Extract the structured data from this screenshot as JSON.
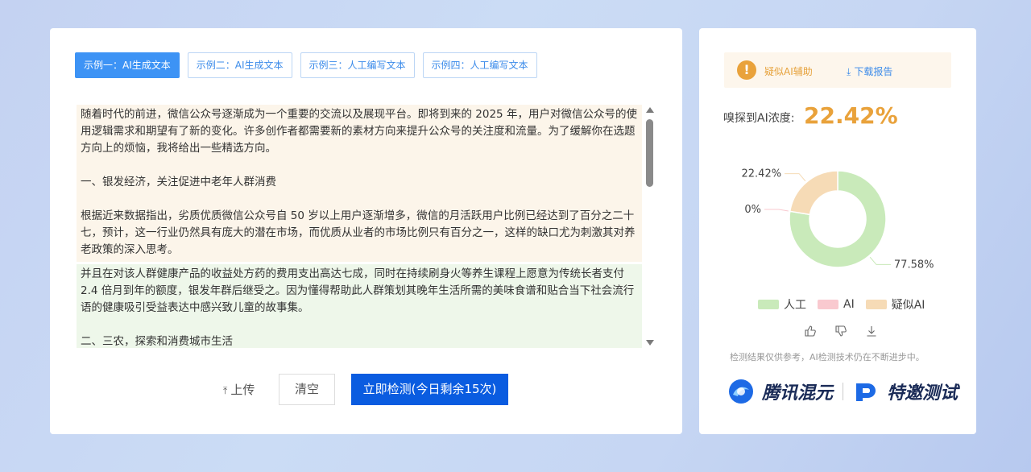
{
  "tabs": [
    {
      "label": "示例一：AI生成文本",
      "active": true
    },
    {
      "label": "示例二：AI生成文本",
      "active": false
    },
    {
      "label": "示例三：人工编写文本",
      "active": false
    },
    {
      "label": "示例四：人工编写文本",
      "active": false
    }
  ],
  "text": {
    "para1": "随着时代的前进，微信公众号逐渐成为一个重要的交流以及展现平台。即将到来的 2025 年，用户对微信公众号的使用逻辑需求和期望有了新的变化。许多创作者都需要新的素材方向来提升公众号的关注度和流量。为了缓解你在选题方向上的烦恼，我将给出一些精选方向。",
    "para2": "一、银发经济，关注促进中老年人群消费",
    "para3": "根据近来数据指出，劣质优质微信公众号自 50 岁以上用户逐渐增多，微信的月活跃用户比例已经达到了百分之二十七，预计，这一行业仍然具有庞大的潜在市场，而优质从业者的市场比例只有百分之一，这样的缺口尤为刺激其对养老政策的深入思考。",
    "para4": "并且在对该人群健康产品的收益处方药的费用支出高达七成，同时在持续刷身火等养生课程上愿意为传统长者支付 2.4 倍月到年的额度，银发年群后继受之。因为懂得帮助此人群策划其晚年生活所需的美味食谱和贴合当下社会流行语的健康吸引受益表达中感兴致儿童的故事集。",
    "para5": "二、三农，探索和消费城市生活"
  },
  "actions": {
    "upload_label": "上传",
    "clear_label": "清空",
    "detect_label": "立即检测(今日剩余15次)"
  },
  "result": {
    "alert_icon": "!",
    "alert_text": "疑似AI辅助",
    "download_label": "下载报告",
    "concentration_label": "嗅探到AI浓度:",
    "concentration_value": "22.42%",
    "disclaimer": "检测结果仅供参考，AI检测技术仍在不断进步中。",
    "brand_tencent": "腾讯混元",
    "brand_test": "特邀测试"
  },
  "chart_data": {
    "type": "pie",
    "style": "donut",
    "series": [
      {
        "name": "人工",
        "value": 77.58,
        "label": "77.58%",
        "color": "#c9eaba"
      },
      {
        "name": "AI",
        "value": 0,
        "label": "0%",
        "color": "#f9c9cf"
      },
      {
        "name": "疑似AI",
        "value": 22.42,
        "label": "22.42%",
        "color": "#f6dbb6"
      }
    ],
    "legend_position": "bottom"
  },
  "icons": {
    "upload": "upload-arrow-icon",
    "download": "download-icon",
    "alert": "warning-icon",
    "feedback": [
      "thumbs-up-icon",
      "thumbs-down-icon",
      "download-icon"
    ]
  }
}
